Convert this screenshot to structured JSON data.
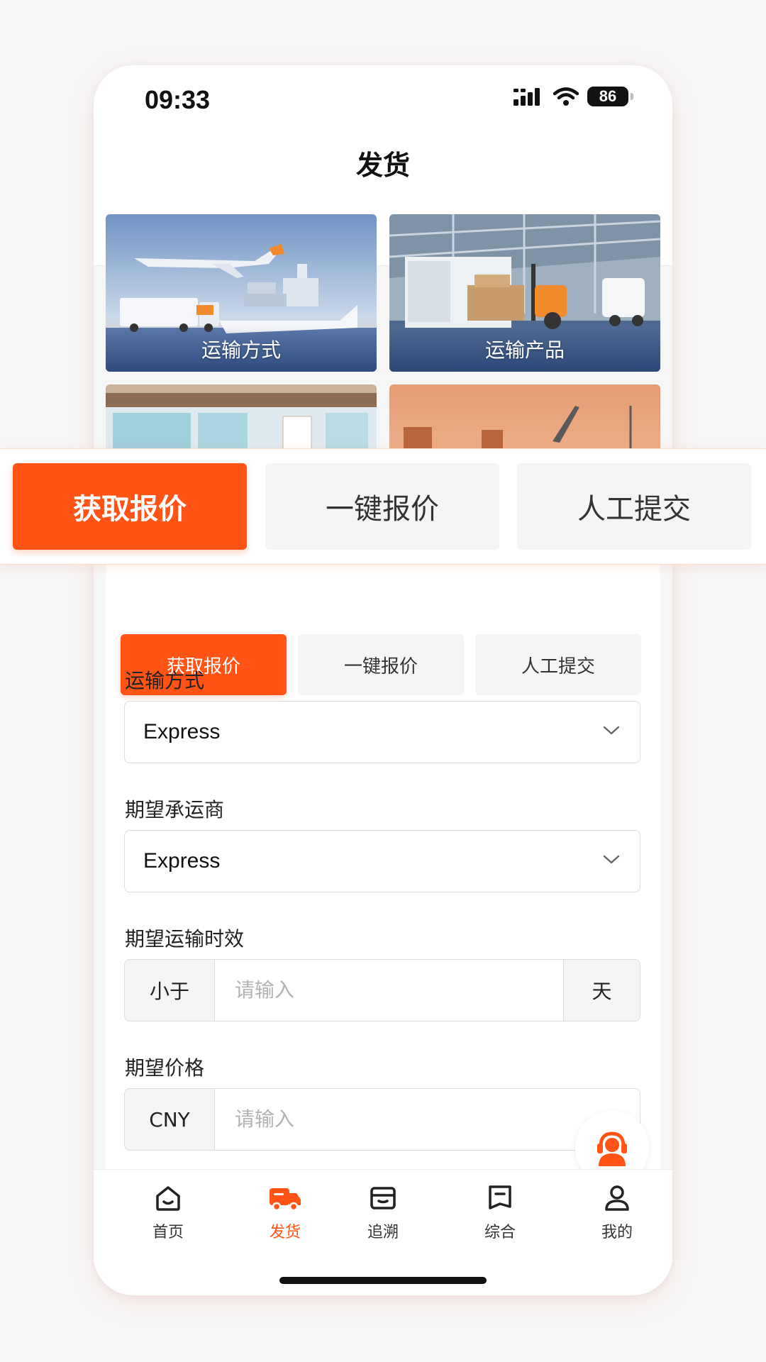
{
  "status": {
    "time": "09:33",
    "battery": "86"
  },
  "header": {
    "title": "发货"
  },
  "tiles": [
    {
      "label": "运输方式"
    },
    {
      "label": "运输产品"
    }
  ],
  "segments": [
    {
      "label": "获取报价",
      "active": true
    },
    {
      "label": "一键报价",
      "active": false
    },
    {
      "label": "人工提交",
      "active": false
    }
  ],
  "form": {
    "transport_method": {
      "label": "运输方式",
      "required_mark": "*",
      "value": "Express"
    },
    "carrier": {
      "label": "期望承运商",
      "value": "Express"
    },
    "duration": {
      "label": "期望运输时效",
      "prefix": "小于",
      "placeholder": "请输入",
      "suffix": "天"
    },
    "price": {
      "label": "期望价格",
      "prefix": "CNY",
      "placeholder": "请输入"
    }
  },
  "tabbar": {
    "items": [
      {
        "label": "首页",
        "icon": "home-icon"
      },
      {
        "label": "发货",
        "icon": "truck-icon",
        "active": true
      },
      {
        "label": "追溯",
        "icon": "wallet-icon"
      },
      {
        "label": "综合",
        "icon": "bookmark-icon"
      },
      {
        "label": "我的",
        "icon": "user-icon"
      }
    ]
  },
  "colors": {
    "accent": "#ff5416",
    "background": "#f6f6f7"
  }
}
